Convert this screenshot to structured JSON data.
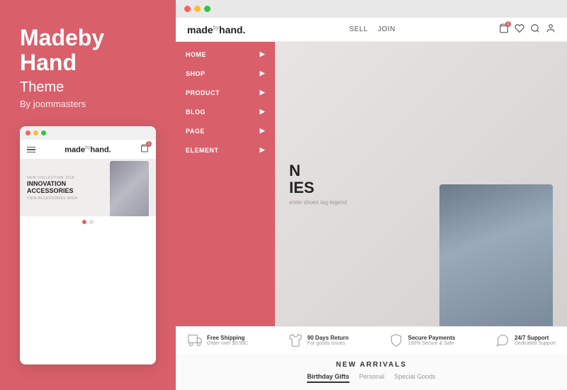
{
  "leftPanel": {
    "title": "Madeby Hand",
    "subtitle": "Theme",
    "by": "By joommasters"
  },
  "miniBrowser": {
    "dots": [
      "red",
      "yellow",
      "green"
    ],
    "header": {
      "logoText": "made",
      "logoSup": "by",
      "logoEnd": "hand.",
      "badgeCount": "1"
    },
    "hero": {
      "label": "NEW COLLECTION 2018",
      "title": "INNOVATION\nACCESSORIES",
      "cta": "VIEW ACCESSORIES SHOP"
    },
    "dots_indicator": [
      true,
      false
    ]
  },
  "browser": {
    "dots": [
      "red",
      "yellow",
      "green"
    ],
    "header": {
      "logoText": "made",
      "logoSup": "by",
      "logoEnd": "hand.",
      "navItems": [
        "SELL",
        "JOIN"
      ],
      "icons": [
        "cart",
        "heart",
        "search",
        "user"
      ]
    },
    "sidebar": {
      "items": [
        {
          "label": "HOME"
        },
        {
          "label": "SHOP"
        },
        {
          "label": "PRODUCT"
        },
        {
          "label": "BLOG"
        },
        {
          "label": "PAGE"
        },
        {
          "label": "ELEMENT"
        }
      ]
    },
    "hero": {
      "bigTitle": "N\nIES",
      "smallText": "enter shoes tag legend"
    },
    "features": [
      {
        "icon": "truck",
        "title": "Free Shipping",
        "sub": "Order over $9.99C"
      },
      {
        "icon": "shirt",
        "title": "90 Days Return",
        "sub": "For goods issues"
      },
      {
        "icon": "shield",
        "title": "Secure Payments",
        "sub": "100% Secure & Safe"
      },
      {
        "icon": "support",
        "title": "24/7 Support",
        "sub": "Dedicated Support"
      }
    ],
    "newArrivals": {
      "title": "NEW ARRIVALS",
      "tabs": [
        {
          "label": "Birthday Gifts",
          "active": true
        },
        {
          "label": "Personal",
          "active": false
        },
        {
          "label": "Special Goods",
          "active": false
        }
      ]
    }
  }
}
